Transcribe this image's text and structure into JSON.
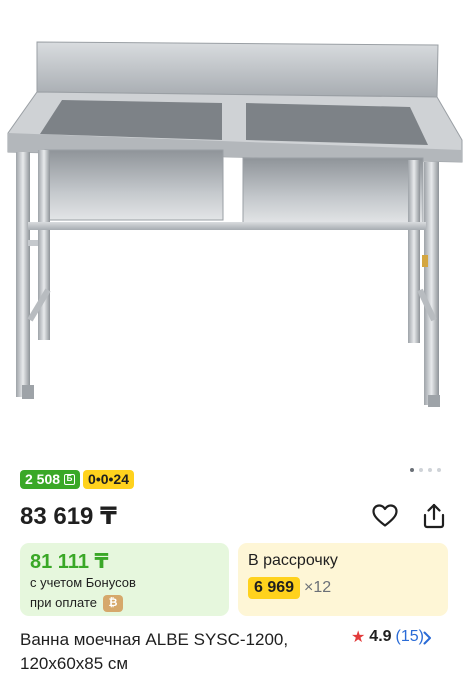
{
  "product": {
    "image_alt": "stainless steel double sink",
    "carousel": {
      "total": 4,
      "active": 1
    },
    "bonus_badge": "2 508",
    "bonus_badge_icon": "bonus-b-icon",
    "installment_badge": "0•0•24",
    "price": "83 619 ₸",
    "bonus_card": {
      "price": "81 111 ₸",
      "line1": "с учетом Бонусов",
      "line2": "при оплате",
      "pay_icon": "payment-icon"
    },
    "installment_card": {
      "title": "В рассрочку",
      "amount": "6 969",
      "times": "×12"
    },
    "title": "Ванна моечная ALBE SYSC-1200, 120x60x85 см",
    "rating": "4.9",
    "reviews": "(15)"
  },
  "colors": {
    "green": "#3aa827",
    "yellow": "#ffd21d",
    "link_blue": "#2a6bd6",
    "star_red": "#e23b3b"
  }
}
